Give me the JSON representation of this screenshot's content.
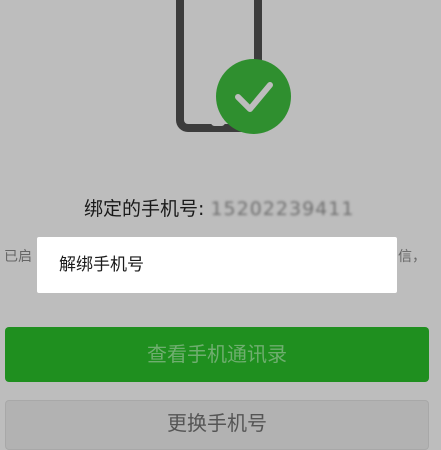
{
  "binding": {
    "label": "绑定的手机号: ",
    "phone_number": "15202239411"
  },
  "side_text": {
    "left": "已启",
    "right": "信，"
  },
  "buttons": {
    "view_contacts": "查看手机通讯录",
    "change_phone": "更换手机号"
  },
  "popup_menu": {
    "items": [
      {
        "label": "解绑手机号"
      }
    ]
  },
  "colors": {
    "overlay_gray": "#bdbdbd",
    "check_badge": "#2f8f2f",
    "primary_button": "#1f8f1f"
  },
  "icons": {
    "phone": "phone-icon",
    "check": "check-icon"
  }
}
